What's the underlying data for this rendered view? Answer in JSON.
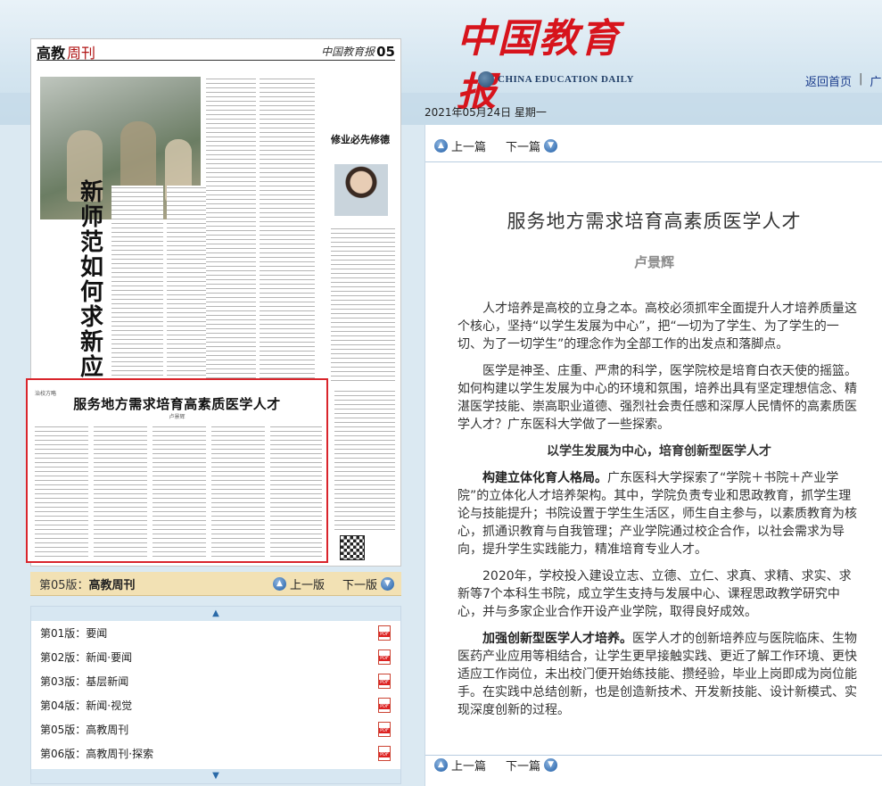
{
  "header": {
    "masthead_title": "中国教育报",
    "masthead_en": "CHINA EDUCATION DAILY",
    "links": [
      "返回首页",
      "广告"
    ]
  },
  "date": "2021年05月24日 星期一",
  "newspaper": {
    "section": "高教",
    "section_suffix": "周刊",
    "brand": "中国教育报",
    "page_num": "05",
    "vertical_title": "新师范如何求新应变",
    "opinion_title": "修业必先修德",
    "highlight_title": "服务地方需求培育高素质医学人才",
    "highlight_author": "卢景辉",
    "highlight_tag": "治校方略"
  },
  "edition_bar": {
    "current_prefix": "第05版：",
    "current_name": "高教周刊",
    "prev_label": "上一版",
    "next_label": "下一版"
  },
  "edition_list": [
    {
      "num": "第01版：",
      "name": "要闻"
    },
    {
      "num": "第02版：",
      "name": "新闻·要闻"
    },
    {
      "num": "第03版：",
      "name": "基层新闻"
    },
    {
      "num": "第04版：",
      "name": "新闻·视觉"
    },
    {
      "num": "第05版：",
      "name": "高教周刊"
    },
    {
      "num": "第06版：",
      "name": "高教周刊·探索"
    }
  ],
  "article": {
    "prev_label": "上一篇",
    "next_label": "下一篇",
    "title": "服务地方需求培育高素质医学人才",
    "author": "卢景辉",
    "p1": "人才培养是高校的立身之本。高校必须抓牢全面提升人才培养质量这个核心，坚持“以学生发展为中心”，把“一切为了学生、为了学生的一切、为了一切学生”的理念作为全部工作的出发点和落脚点。",
    "p2": "医学是神圣、庄重、严肃的科学，医学院校是培育白衣天使的摇篮。如何构建以学生发展为中心的环境和氛围，培养出具有坚定理想信念、精湛医学技能、崇高职业道德、强烈社会责任感和深厚人民情怀的高素质医学人才？广东医科大学做了一些探索。",
    "subhead": "以学生发展为中心，培育创新型医学人才",
    "p3_bold": "构建立体化育人格局。",
    "p3": "广东医科大学探索了“学院＋书院＋产业学院”的立体化人才培养架构。其中，学院负责专业和思政教育，抓学生理论与技能提升；书院设置于学生生活区，师生自主参与，以素质教育为核心，抓通识教育与自我管理；产业学院通过校企合作，以社会需求为导向，提升学生实践能力，精准培育专业人才。",
    "p4": "2020年，学校投入建设立志、立德、立仁、求真、求精、求实、求新等7个本科生书院，成立学生支持与发展中心、课程思政教学研究中心，并与多家企业合作开设产业学院，取得良好成效。",
    "p5_bold": "加强创新型医学人才培养。",
    "p5": "医学人才的创新培养应与医院临床、生物医药产业应用等相结合，让学生更早接触实践、更近了解工作环境、更快适应工作岗位，未出校门便开始练技能、攒经验，毕业上岗即成为岗位能手。在实践中总结创新，也是创造新技术、开发新技能、设计新模式、实现深度创新的过程。"
  }
}
